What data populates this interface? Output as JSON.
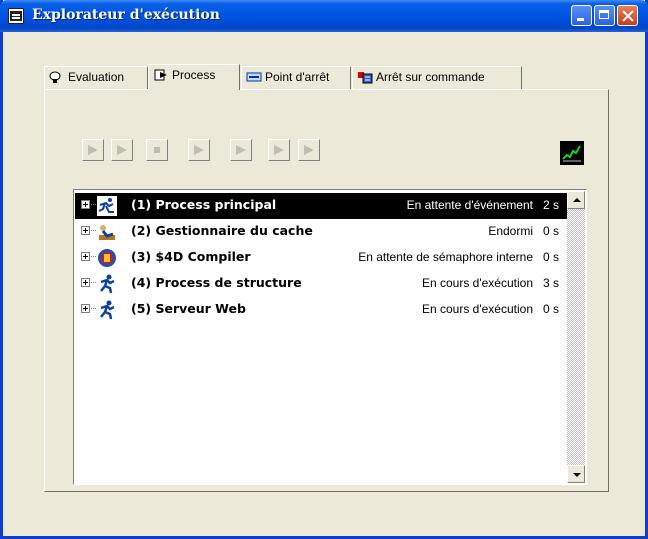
{
  "window": {
    "title": "Explorateur d'exécution"
  },
  "tabs": [
    {
      "label": "Evaluation",
      "icon": "key-eval-icon"
    },
    {
      "label": "Process",
      "icon": "process-icon",
      "active": true
    },
    {
      "label": "Point d'arrêt",
      "icon": "breakpoint-icon"
    },
    {
      "label": "Arrêt sur commande",
      "icon": "command-stop-icon"
    }
  ],
  "toolbar": {
    "buttons": [
      "run-icon",
      "run-pause-icon",
      "stop-icon",
      "debug-icon",
      "step-icon",
      "step-over-icon",
      "trace-icon"
    ],
    "graph_icon": "activity-graph-icon"
  },
  "processes": [
    {
      "name": "(1) Process principal",
      "status": "En attente d'événement",
      "time": "2 s",
      "icon": "running-man-icon",
      "selected": true
    },
    {
      "name": "(2) Gestionnaire du cache",
      "status": "Endormi",
      "time": "0 s",
      "icon": "sleeping-figure-icon"
    },
    {
      "name": "(3) $4D Compiler",
      "status": "En attente de sémaphore interne",
      "time": "0 s",
      "icon": "4d-compiler-icon"
    },
    {
      "name": "(4) Process de structure",
      "status": "En cours d'exécution",
      "time": "3 s",
      "icon": "running-man-blue-icon"
    },
    {
      "name": "(5) Serveur Web",
      "status": "En cours d'exécution",
      "time": "0 s",
      "icon": "running-man-blue-icon"
    }
  ]
}
